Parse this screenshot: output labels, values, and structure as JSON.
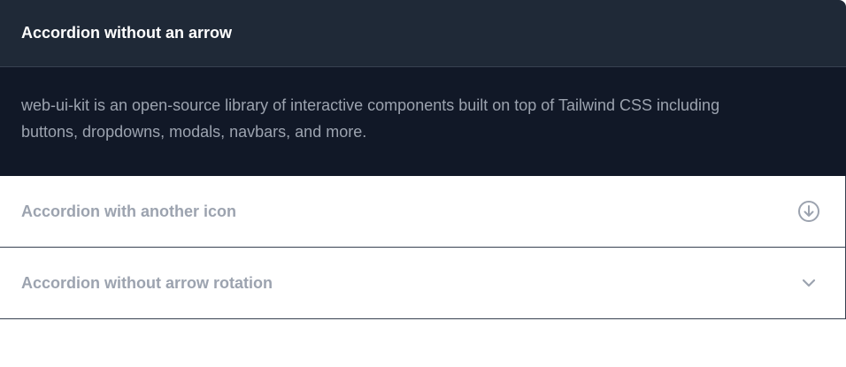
{
  "accordion": {
    "items": [
      {
        "title": "Accordion without an arrow",
        "body": "web-ui-kit is an open-source library of interactive components built on top of Tailwind CSS including buttons, dropdowns, modals, navbars, and more.",
        "open": true
      },
      {
        "title": "Accordion with another icon",
        "icon": "arrow-down-circle-icon",
        "open": false
      },
      {
        "title": "Accordion without arrow rotation",
        "icon": "chevron-down-icon",
        "open": false
      }
    ]
  },
  "colors": {
    "open_header_bg": "#1f2937",
    "open_body_bg": "#111827",
    "muted_text": "#9ca3af",
    "border": "#374151"
  }
}
